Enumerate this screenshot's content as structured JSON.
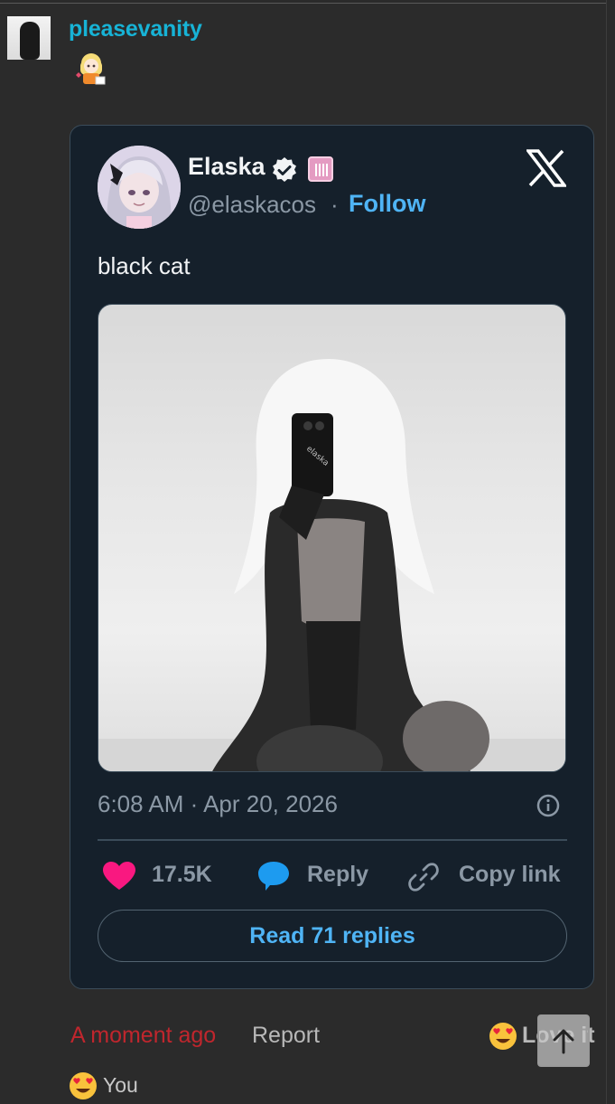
{
  "post": {
    "username": "pleasevanity"
  },
  "embed": {
    "author_name": "Elaska",
    "author_handle": "@elaskacos",
    "separator": "·",
    "follow_label": "Follow",
    "tweet_text": "black cat",
    "image_watermark": "elaska",
    "timestamp": "6:08 AM · Apr 20, 2026",
    "likes_count": "17.5K",
    "reply_label": "Reply",
    "copy_link_label": "Copy link",
    "read_replies_label": "Read 71 replies",
    "colors": {
      "background": "#15202b",
      "link_blue": "#4fb4f5",
      "heart": "#f91880",
      "reply_bubble": "#1d9bf0",
      "muted": "#8b98a5"
    }
  },
  "footer": {
    "time_label": "A moment ago",
    "report_label": "Report",
    "reaction_label": "Love it",
    "reactions": [
      {
        "emoji": "heart-eyes",
        "label": "You"
      }
    ]
  },
  "icons": [
    "verified-check-icon",
    "affiliate-badge-icon",
    "x-logo-icon",
    "info-icon",
    "heart-icon",
    "reply-bubble-icon",
    "link-icon",
    "heart-eyes-emoji-icon",
    "arrow-up-icon"
  ]
}
